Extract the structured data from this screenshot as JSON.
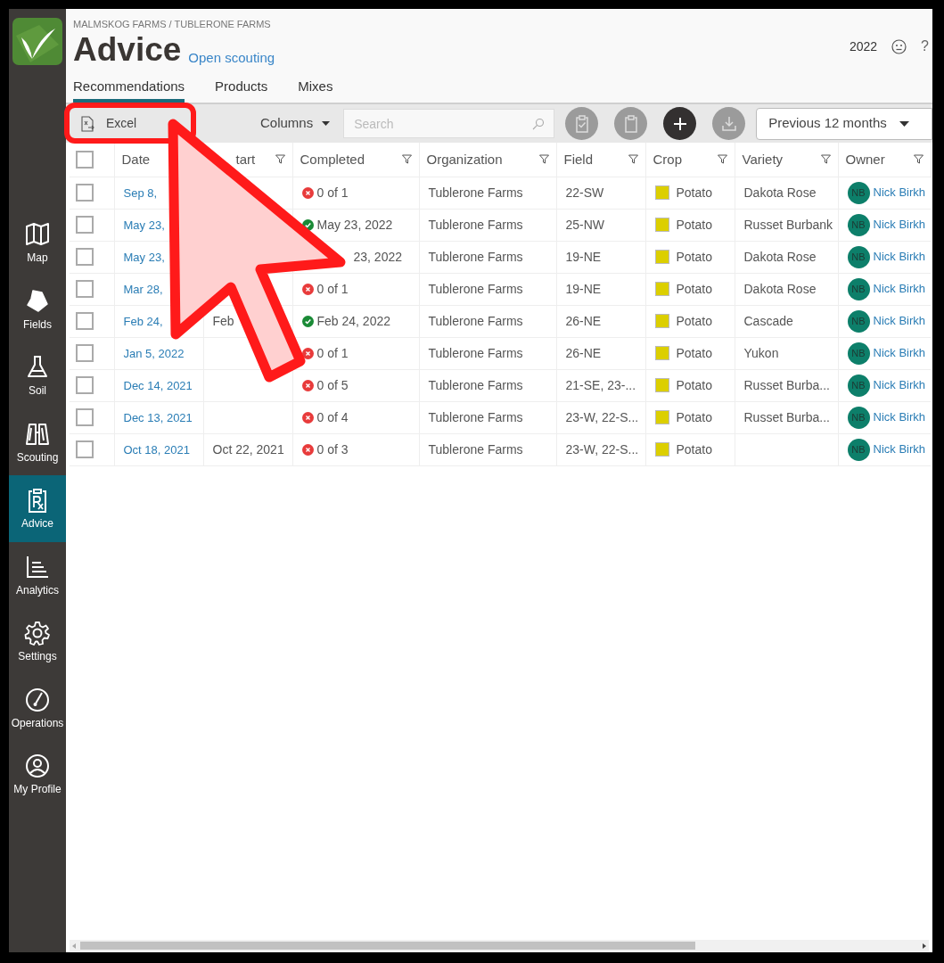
{
  "header": {
    "breadcrumb": "MALMSKOG FARMS / TUBLERONE FARMS",
    "title": "Advice",
    "link": "Open scouting",
    "year": "2022",
    "help": "?"
  },
  "sidebar": {
    "items": [
      {
        "label": "Map",
        "selected": false
      },
      {
        "label": "Fields",
        "selected": false
      },
      {
        "label": "Soil",
        "selected": false
      },
      {
        "label": "Scouting",
        "selected": false
      },
      {
        "label": "Advice",
        "selected": true
      },
      {
        "label": "Analytics",
        "selected": false
      },
      {
        "label": "Settings",
        "selected": false
      },
      {
        "label": "Operations",
        "selected": false
      },
      {
        "label": "My Profile",
        "selected": false
      }
    ]
  },
  "tabs": [
    {
      "label": "Recommendations",
      "selected": true
    },
    {
      "label": "Products",
      "selected": false
    },
    {
      "label": "Mixes",
      "selected": false
    }
  ],
  "toolbar": {
    "excel": "Excel",
    "columns": "Columns",
    "search": {
      "placeholder": "Search"
    },
    "actions": [
      {
        "kind": "clipboard-check",
        "enabled": false
      },
      {
        "kind": "clipboard",
        "enabled": false
      },
      {
        "kind": "plus",
        "enabled": true
      },
      {
        "kind": "download",
        "enabled": false
      }
    ],
    "period": "Previous 12 months"
  },
  "table": {
    "all_checked": false,
    "columns": [
      "Date",
      "tart",
      "Completed",
      "Organization",
      "Field",
      "Crop",
      "Variety",
      "Owner"
    ],
    "rows": [
      {
        "checked": false,
        "date": "Sep 8,",
        "start": "",
        "completed": {
          "done": false,
          "text": "0 of 1"
        },
        "organization": "Tublerone Farms",
        "field": "22-SW",
        "crop": {
          "name": "Potato",
          "color": "#dccf00"
        },
        "variety": "Dakota Rose",
        "owner": {
          "initials": "NB",
          "name": "Nick Birkh"
        }
      },
      {
        "checked": false,
        "date": "May 23,",
        "start": "",
        "completed": {
          "done": true,
          "text": "May 23, 2022"
        },
        "organization": "Tublerone Farms",
        "field": "25-NW",
        "crop": {
          "name": "Potato",
          "color": "#dccf00"
        },
        "variety": "Russet Burbank",
        "owner": {
          "initials": "NB",
          "name": "Nick Birkh"
        }
      },
      {
        "checked": false,
        "date": "May 23,",
        "start": "",
        "completed": {
          "text": "23, 2022"
        },
        "organization": "Tublerone Farms",
        "field": "19-NE",
        "crop": {
          "name": "Potato",
          "color": "#dccf00"
        },
        "variety": "Dakota Rose",
        "owner": {
          "initials": "NB",
          "name": "Nick Birkh"
        }
      },
      {
        "checked": false,
        "date": "Mar 28,",
        "start": "",
        "completed": {
          "done": false,
          "text": "0 of 1"
        },
        "organization": "Tublerone Farms",
        "field": "19-NE",
        "crop": {
          "name": "Potato",
          "color": "#dccf00"
        },
        "variety": "Dakota Rose",
        "owner": {
          "initials": "NB",
          "name": "Nick Birkh"
        }
      },
      {
        "checked": false,
        "date": "Feb 24,",
        "start": "Feb",
        "completed": {
          "done": true,
          "text": "Feb 24, 2022"
        },
        "organization": "Tublerone Farms",
        "field": "26-NE",
        "crop": {
          "name": "Potato",
          "color": "#dccf00"
        },
        "variety": "Cascade",
        "owner": {
          "initials": "NB",
          "name": "Nick Birkh"
        }
      },
      {
        "checked": false,
        "date": "Jan 5, 2022",
        "start": "",
        "completed": {
          "done": false,
          "text": "0 of 1"
        },
        "organization": "Tublerone Farms",
        "field": "26-NE",
        "crop": {
          "name": "Potato",
          "color": "#dccf00"
        },
        "variety": "Yukon",
        "owner": {
          "initials": "NB",
          "name": "Nick Birkh"
        }
      },
      {
        "checked": false,
        "date": "Dec 14, 2021",
        "start": "",
        "completed": {
          "done": false,
          "text": "0 of 5"
        },
        "organization": "Tublerone Farms",
        "field": "21-SE, 23-...",
        "crop": {
          "name": "Potato",
          "color": "#dccf00"
        },
        "variety": "Russet Burba...",
        "owner": {
          "initials": "NB",
          "name": "Nick Birkh"
        }
      },
      {
        "checked": false,
        "date": "Dec 13, 2021",
        "start": "",
        "completed": {
          "done": false,
          "text": "0 of 4"
        },
        "organization": "Tublerone Farms",
        "field": "23-W, 22-S...",
        "crop": {
          "name": "Potato",
          "color": "#dccf00"
        },
        "variety": "Russet Burba...",
        "owner": {
          "initials": "NB",
          "name": "Nick Birkh"
        }
      },
      {
        "checked": false,
        "date": "Oct 18, 2021",
        "start": "Oct 22, 2021",
        "completed": {
          "done": false,
          "text": "0 of 3"
        },
        "organization": "Tublerone Farms",
        "field": "23-W, 22-S...",
        "crop": {
          "name": "Potato",
          "color": "#dccf00"
        },
        "variety": "",
        "owner": {
          "initials": "NB",
          "name": "Nick Birkh"
        }
      }
    ]
  }
}
